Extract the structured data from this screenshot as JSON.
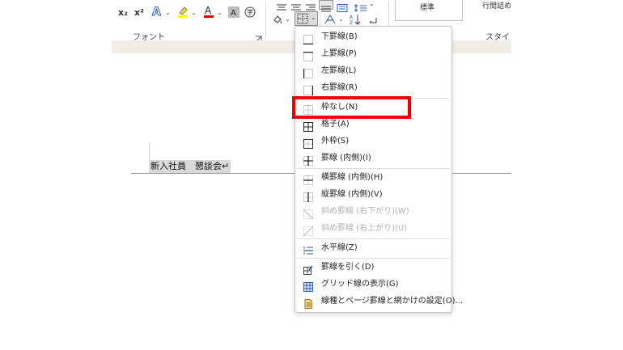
{
  "ribbon": {
    "font_group_label": "フォント",
    "style_group_label": "スタイル",
    "style_item_1": "標準",
    "style_item_2": "行間詰め",
    "subscript": "x₂",
    "superscript": "x²"
  },
  "document": {
    "text": "新入社員　懇談会↵"
  },
  "menu": {
    "items": [
      {
        "label": "下罫線(B)",
        "icon": "border-bottom-icon",
        "disabled": false
      },
      {
        "label": "上罫線(P)",
        "icon": "border-top-icon",
        "disabled": false
      },
      {
        "label": "左罫線(L)",
        "icon": "border-left-icon",
        "disabled": false
      },
      {
        "label": "右罫線(R)",
        "icon": "border-right-icon",
        "disabled": false
      },
      {
        "label": "枠なし(N)",
        "icon": "border-none-icon",
        "disabled": false
      },
      {
        "label": "格子(A)",
        "icon": "border-all-icon",
        "disabled": false
      },
      {
        "label": "外枠(S)",
        "icon": "border-outside-icon",
        "disabled": false
      },
      {
        "label": "罫線 (内側)(I)",
        "icon": "border-inside-icon",
        "disabled": false
      },
      {
        "label": "横罫線 (内側)(H)",
        "icon": "border-inside-horizontal-icon",
        "disabled": false
      },
      {
        "label": "縦罫線 (内側)(V)",
        "icon": "border-inside-vertical-icon",
        "disabled": false
      },
      {
        "label": "斜め罫線 (右下がり)(W)",
        "icon": "diagonal-down-border-icon",
        "disabled": true
      },
      {
        "label": "斜め罫線 (右上がり)(U)",
        "icon": "diagonal-up-border-icon",
        "disabled": true
      },
      {
        "label": "水平線(Z)",
        "icon": "horizontal-line-icon",
        "disabled": false
      },
      {
        "label": "罫線を引く(D)",
        "icon": "draw-table-icon",
        "disabled": false
      },
      {
        "label": "グリッド線の表示(G)",
        "icon": "view-gridlines-icon",
        "disabled": false
      },
      {
        "label": "線種とページ罫線と網かけの設定(O)...",
        "icon": "borders-shading-icon",
        "disabled": false
      }
    ]
  },
  "colors": {
    "highlight": "#f00000",
    "font_color_bar": "#e00000",
    "highlighter_bar": "#ffff00"
  }
}
